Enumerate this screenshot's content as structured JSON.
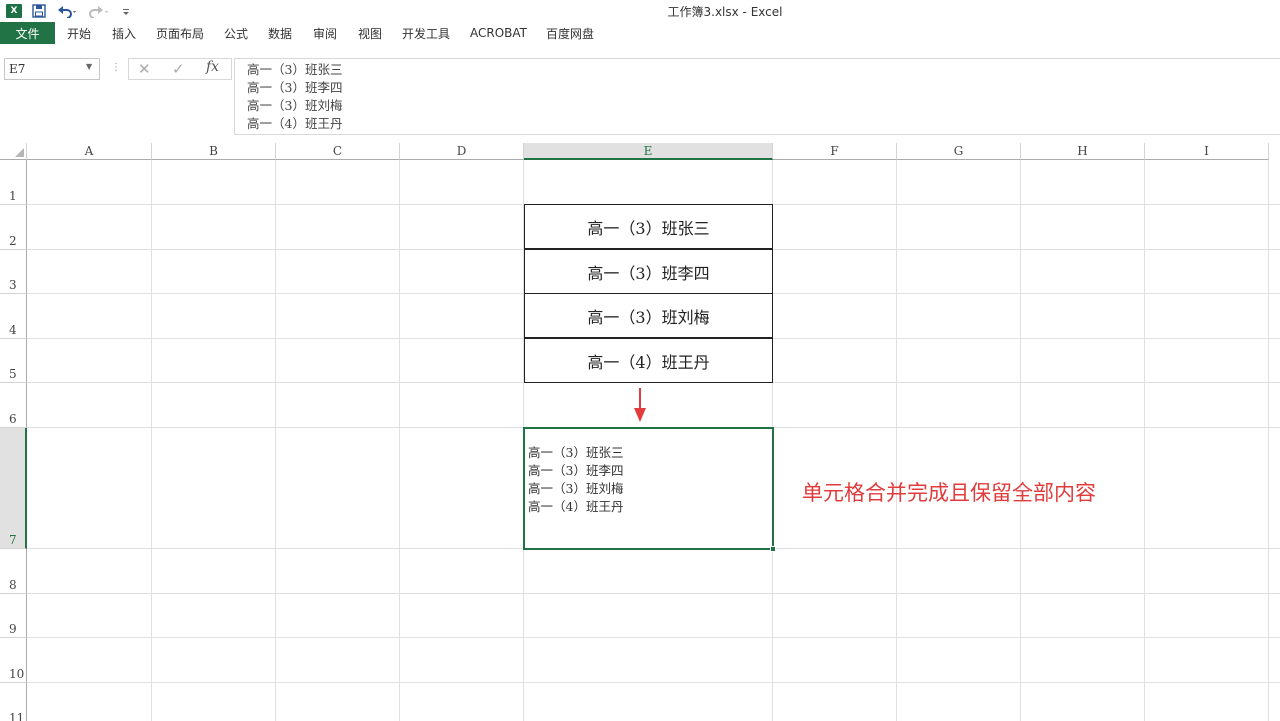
{
  "window": {
    "title": "工作簿3.xlsx - Excel"
  },
  "quick_access": {
    "app_icon": "excel-icon",
    "app_icon_letter": "X",
    "icons": [
      "save-icon",
      "undo-icon",
      "redo-icon",
      "customize-quick-access-icon"
    ]
  },
  "ribbon": {
    "file_tab": "文件",
    "tabs": [
      "开始",
      "插入",
      "页面布局",
      "公式",
      "数据",
      "审阅",
      "视图",
      "开发工具",
      "ACROBAT",
      "百度网盘"
    ]
  },
  "formula_bar": {
    "name_box": "E7",
    "fx_label": "fx",
    "cancel_glyph": "✕",
    "enter_glyph": "✓",
    "content_lines": [
      "高一（3）班张三",
      "高一（3）班李四",
      "高一（3）班刘梅",
      "高一（4）班王丹"
    ]
  },
  "sheet": {
    "columns": [
      "A",
      "B",
      "C",
      "D",
      "E",
      "F",
      "G",
      "H",
      "I"
    ],
    "selected_column": "E",
    "rows": [
      "1",
      "2",
      "3",
      "4",
      "5",
      "6",
      "7",
      "8",
      "9",
      "10",
      "11"
    ],
    "selected_row": "7",
    "source_cells": [
      "高一（3）班张三",
      "高一（3）班李四",
      "高一（3）班刘梅",
      "高一（4）班王丹"
    ],
    "merged_cell_lines": [
      "高一（3）班张三",
      "高一（3）班李四",
      "高一（3）班刘梅",
      "高一（4）班王丹"
    ],
    "annotation": "单元格合并完成且保留全部内容",
    "accent_color": "#217346",
    "annotation_color": "#e03c3c"
  }
}
